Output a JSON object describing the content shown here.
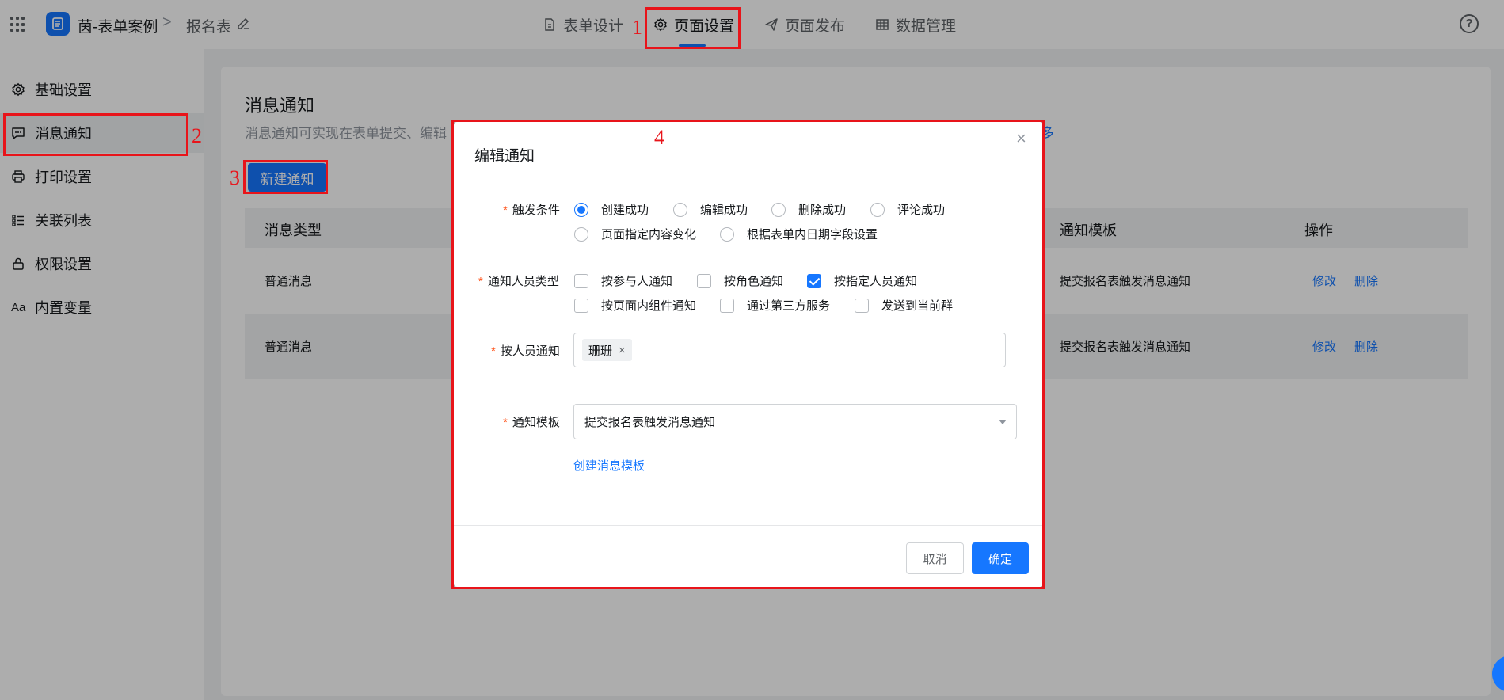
{
  "header": {
    "app_name": "茵-表单案例",
    "breadcrumb_sep": ">",
    "page_name": "报名表",
    "tabs": [
      {
        "label": "表单设计",
        "icon": "file-icon"
      },
      {
        "label": "页面设置",
        "icon": "gear-icon",
        "active": true
      },
      {
        "label": "页面发布",
        "icon": "send-icon"
      },
      {
        "label": "数据管理",
        "icon": "table-icon"
      }
    ],
    "help": "?"
  },
  "sidebar": {
    "items": [
      {
        "label": "基础设置",
        "icon": "gear-icon"
      },
      {
        "label": "消息通知",
        "icon": "message-icon",
        "active": true
      },
      {
        "label": "打印设置",
        "icon": "printer-icon"
      },
      {
        "label": "关联列表",
        "icon": "list-icon"
      },
      {
        "label": "权限设置",
        "icon": "lock-icon"
      },
      {
        "label": "内置变量",
        "icon": "text-icon",
        "icon_text": "Aa"
      }
    ]
  },
  "main": {
    "title": "消息通知",
    "description": "消息通知可实现在表单提交、编辑",
    "description_link": "多",
    "new_button": "新建通知",
    "table": {
      "headers": [
        "消息类型",
        "通知模板",
        "操作"
      ],
      "rows": [
        {
          "type": "普通消息",
          "template": "提交报名表触发消息通知",
          "edit": "修改",
          "delete": "删除"
        },
        {
          "type": "普通消息",
          "template": "提交报名表触发消息通知",
          "edit": "修改",
          "delete": "删除"
        }
      ]
    }
  },
  "modal": {
    "title": "编辑通知",
    "close": "×",
    "trigger": {
      "label": "触发条件",
      "options": [
        {
          "label": "创建成功",
          "checked": true
        },
        {
          "label": "编辑成功",
          "checked": false
        },
        {
          "label": "删除成功",
          "checked": false
        },
        {
          "label": "评论成功",
          "checked": false
        },
        {
          "label": "页面指定内容变化",
          "checked": false
        },
        {
          "label": "根据表单内日期字段设置",
          "checked": false
        }
      ]
    },
    "recipient_type": {
      "label": "通知人员类型",
      "options": [
        {
          "label": "按参与人通知",
          "checked": false
        },
        {
          "label": "按角色通知",
          "checked": false
        },
        {
          "label": "按指定人员通知",
          "checked": true
        },
        {
          "label": "按页面内组件通知",
          "checked": false
        },
        {
          "label": "通过第三方服务",
          "checked": false
        },
        {
          "label": "发送到当前群",
          "checked": false
        }
      ]
    },
    "by_person": {
      "label": "按人员通知",
      "tags": [
        "珊珊"
      ],
      "remove": "×"
    },
    "template": {
      "label": "通知模板",
      "value": "提交报名表触发消息通知",
      "create_link": "创建消息模板"
    },
    "cancel": "取消",
    "confirm": "确定"
  },
  "annotations": {
    "n1": "1",
    "n2": "2",
    "n3": "3",
    "n4": "4",
    "color": "#e8141a"
  },
  "colors": {
    "primary": "#1677ff",
    "required": "#ff5219",
    "annotation": "#e8141a"
  }
}
